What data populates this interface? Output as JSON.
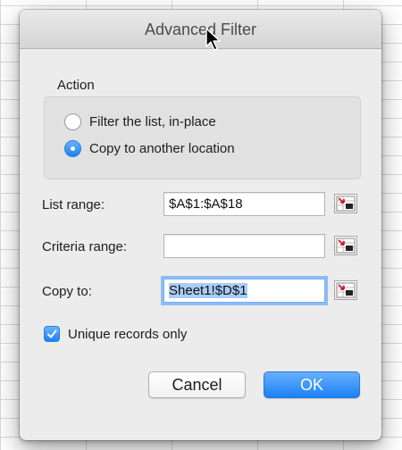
{
  "dialog": {
    "title": "Advanced Filter"
  },
  "action": {
    "label": "Action",
    "options": [
      {
        "label": "Filter the list, in-place",
        "selected": false
      },
      {
        "label": "Copy to another location",
        "selected": true
      }
    ]
  },
  "fields": {
    "list_range": {
      "label": "List range:",
      "value": "$A$1:$A$18"
    },
    "criteria_range": {
      "label": "Criteria range:",
      "value": ""
    },
    "copy_to": {
      "label": "Copy to:",
      "value": "Sheet1!$D$1"
    }
  },
  "unique": {
    "label": "Unique records only",
    "checked": true
  },
  "buttons": {
    "cancel": "Cancel",
    "ok": "OK"
  },
  "colors": {
    "accent": "#1a82f6",
    "dialog_bg": "#ececec"
  },
  "icons": {
    "range_select": "collapse-dialog-icon",
    "cursor": "mouse-pointer-icon"
  }
}
